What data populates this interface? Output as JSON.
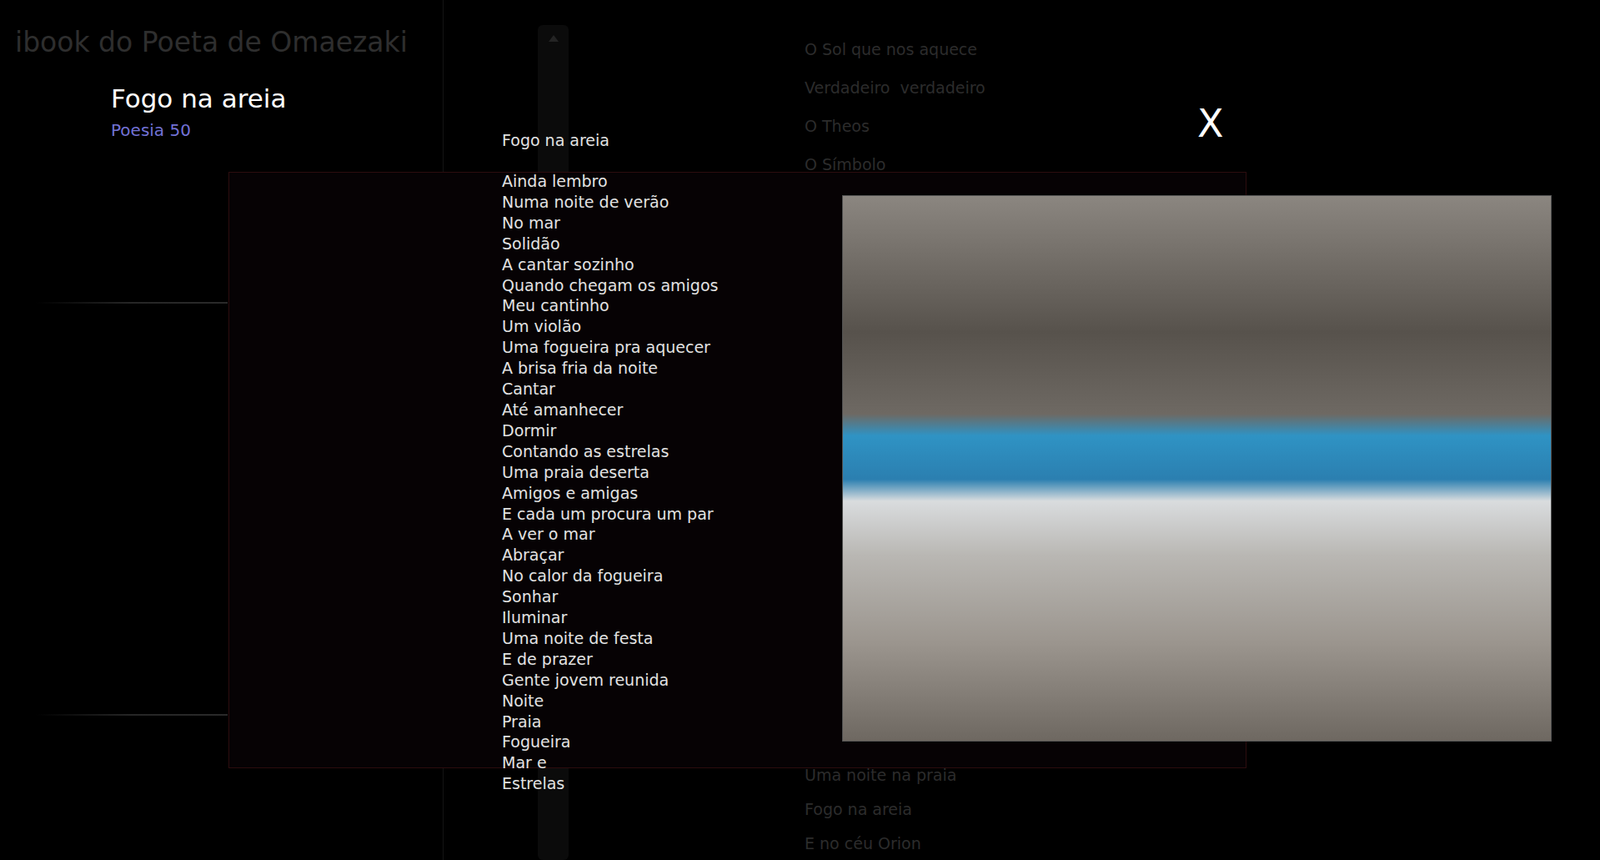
{
  "app": {
    "subtitle": "ibook do Poeta de Omaezaki"
  },
  "background_list": {
    "top": [
      "O Sol que nos aquece",
      "Verdadeiro  verdadeiro",
      "O Theos",
      "O Símbolo"
    ],
    "bottom": [
      "Uma noite na praia",
      "Fogo na areia",
      "E no céu Orion"
    ]
  },
  "poem_header": {
    "title": "Fogo na areia",
    "number": "Poesia 50"
  },
  "modal": {
    "close": "X",
    "poem_title": "Fogo na areia",
    "lines": [
      "Ainda lembro",
      "Numa noite de verão",
      "No mar",
      "Solidão",
      "A cantar sozinho",
      "Quando chegam os amigos",
      "Meu cantinho",
      "Um violão",
      "Uma fogueira pra aquecer",
      "A brisa fria da noite",
      "Cantar",
      "Até amanhecer",
      "Dormir",
      "Contando as estrelas",
      "Uma praia deserta",
      "Amigos e amigas",
      "E cada um procura um par",
      "A ver o mar",
      "Abraçar",
      "No calor da fogueira",
      "Sonhar",
      "Iluminar",
      "Uma noite de festa",
      "E de prazer",
      "Gente jovem reunida",
      "Noite",
      "Praia",
      "Fogueira",
      "Mar e",
      "Estrelas"
    ]
  }
}
